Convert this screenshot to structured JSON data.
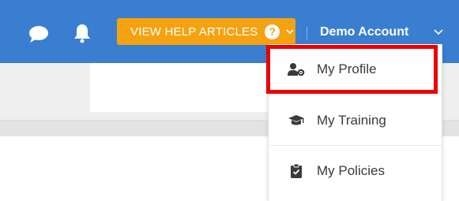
{
  "header": {
    "help_button_label": "VIEW HELP ARTICLES",
    "account_name": "Demo Account",
    "icons": [
      "chat-icon",
      "bell-icon",
      "question-circle-icon",
      "chevron-down-icon"
    ]
  },
  "account_menu": {
    "items": [
      {
        "label": "My Profile",
        "icon": "user-gear-icon",
        "highlighted": true
      },
      {
        "label": "My Training",
        "icon": "graduation-cap-icon"
      },
      {
        "label": "My Policies",
        "icon": "clipboard-check-icon"
      }
    ]
  },
  "colors": {
    "topbar": "#3a7ed0",
    "help_button": "#f5a211",
    "highlight": "#ea0000"
  }
}
